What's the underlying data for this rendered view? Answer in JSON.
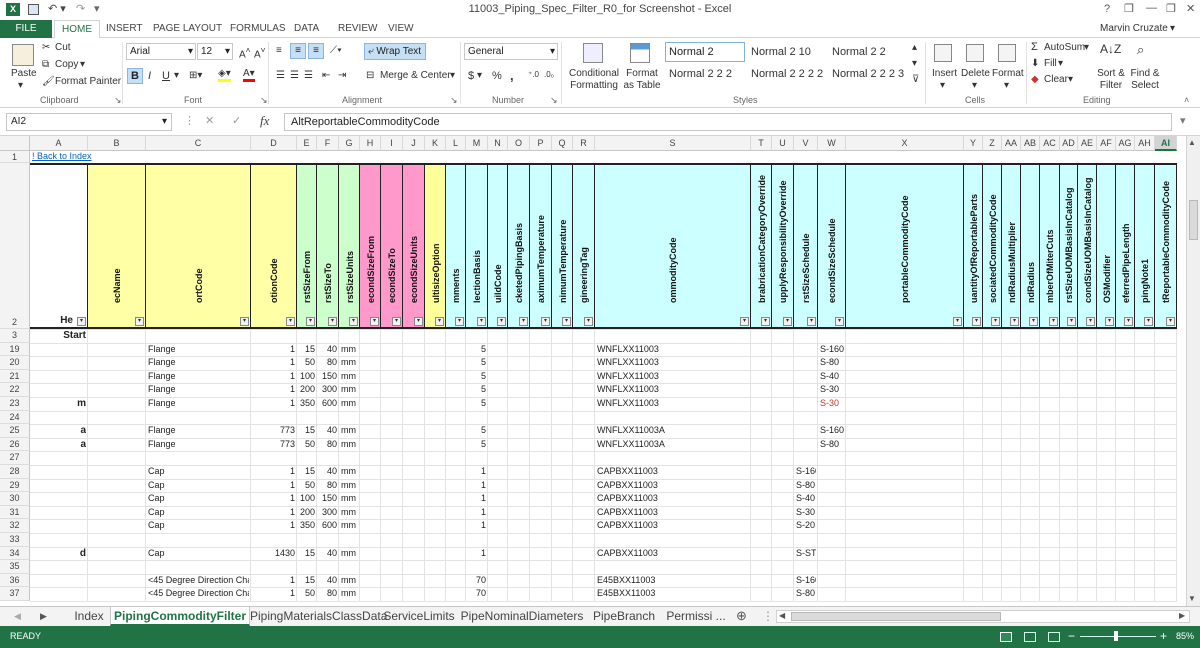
{
  "title_bar": {
    "title": "11003_Piping_Spec_Filter_R0_for Screenshot - Excel",
    "help": "?",
    "minimize": "—",
    "restore": "❐",
    "close": "✕"
  },
  "ribbon_tabs": [
    {
      "id": "file",
      "label": "FILE"
    },
    {
      "id": "home",
      "label": "HOME"
    },
    {
      "id": "insert",
      "label": "INSERT"
    },
    {
      "id": "pagelayout",
      "label": "PAGE LAYOUT"
    },
    {
      "id": "formulas",
      "label": "FORMULAS"
    },
    {
      "id": "data",
      "label": "DATA"
    },
    {
      "id": "review",
      "label": "REVIEW"
    },
    {
      "id": "view",
      "label": "VIEW"
    }
  ],
  "user": "Marvin Cruzate",
  "ribbon": {
    "clipboard": {
      "paste": "Paste",
      "cut": "Cut",
      "copy": "Copy",
      "format_painter": "Format Painter",
      "label": "Clipboard"
    },
    "font": {
      "name": "Arial",
      "size": "12",
      "label": "Font",
      "bold": "B",
      "italic": "I",
      "underline": "U"
    },
    "alignment": {
      "wrap": "Wrap Text",
      "merge": "Merge & Center",
      "label": "Alignment"
    },
    "number": {
      "format": "General",
      "currency": "$",
      "percent": "%",
      "comma": ",",
      "label": "Number"
    },
    "styles": {
      "conditional": "Conditional Formatting",
      "format_as_table": "Format as Table",
      "cells": [
        "Normal 2",
        "Normal 2 10",
        "Normal 2 2",
        "Normal 2 2 2",
        "Normal 2 2 2 2",
        "Normal 2 2 2 3"
      ],
      "label": "Styles"
    },
    "cells": {
      "insert": "Insert",
      "delete": "Delete",
      "format": "Format",
      "label": "Cells"
    },
    "editing": {
      "autosum": "AutoSum",
      "fill": "Fill",
      "clear": "Clear",
      "sort": "Sort & Filter",
      "find": "Find & Select",
      "label": "Editing"
    }
  },
  "formula_bar": {
    "name_box": "AI2",
    "fx": "fx",
    "content": "AltReportableCommodityCode"
  },
  "columns": [
    {
      "letter": "A",
      "width": 58
    },
    {
      "letter": "B",
      "width": 58
    },
    {
      "letter": "C",
      "width": 105
    },
    {
      "letter": "D",
      "width": 46
    },
    {
      "letter": "E",
      "width": 20
    },
    {
      "letter": "F",
      "width": 22
    },
    {
      "letter": "G",
      "width": 21
    },
    {
      "letter": "H",
      "width": 21
    },
    {
      "letter": "I",
      "width": 22
    },
    {
      "letter": "J",
      "width": 22
    },
    {
      "letter": "K",
      "width": 21
    },
    {
      "letter": "L",
      "width": 20
    },
    {
      "letter": "M",
      "width": 22
    },
    {
      "letter": "N",
      "width": 20
    },
    {
      "letter": "O",
      "width": 22
    },
    {
      "letter": "P",
      "width": 22
    },
    {
      "letter": "Q",
      "width": 21
    },
    {
      "letter": "R",
      "width": 22
    },
    {
      "letter": "S",
      "width": 156
    },
    {
      "letter": "T",
      "width": 21
    },
    {
      "letter": "U",
      "width": 22
    },
    {
      "letter": "V",
      "width": 24
    },
    {
      "letter": "W",
      "width": 28
    },
    {
      "letter": "X",
      "width": 118
    },
    {
      "letter": "Y",
      "width": 19
    },
    {
      "letter": "Z",
      "width": 19
    },
    {
      "letter": "AA",
      "width": 19
    },
    {
      "letter": "AB",
      "width": 19
    },
    {
      "letter": "AC",
      "width": 20
    },
    {
      "letter": "AD",
      "width": 18
    },
    {
      "letter": "AE",
      "width": 19
    },
    {
      "letter": "AF",
      "width": 19
    },
    {
      "letter": "AG",
      "width": 19
    },
    {
      "letter": "AH",
      "width": 20
    },
    {
      "letter": "AI",
      "width": 22
    }
  ],
  "header_row": [
    {
      "col": "A",
      "text": "He",
      "color": "#ffffff"
    },
    {
      "col": "B",
      "text": "ecName",
      "color": "#ffffa6"
    },
    {
      "col": "C",
      "text": "ortCode",
      "color": "#ffffa6"
    },
    {
      "col": "D",
      "text": "otionCode",
      "color": "#ffffa6"
    },
    {
      "col": "E",
      "text": "rstSizeFrom",
      "color": "#ccffcc"
    },
    {
      "col": "F",
      "text": "rstSizeTo",
      "color": "#ccffcc"
    },
    {
      "col": "G",
      "text": "rstSizeUnits",
      "color": "#ccffcc"
    },
    {
      "col": "H",
      "text": "econdSizeFrom",
      "color": "#ff99cc"
    },
    {
      "col": "I",
      "text": "econdSizeTo",
      "color": "#ff99cc"
    },
    {
      "col": "J",
      "text": "econdSizeUnits",
      "color": "#ff99cc"
    },
    {
      "col": "K",
      "text": "ultisizeOption",
      "color": "#ffff99"
    },
    {
      "col": "L",
      "text": "mments",
      "color": "#ccffff"
    },
    {
      "col": "M",
      "text": "lectionBasis",
      "color": "#ccffff"
    },
    {
      "col": "N",
      "text": "uildCode",
      "color": "#ccffff"
    },
    {
      "col": "O",
      "text": "cketedPipingBasis",
      "color": "#ccffff"
    },
    {
      "col": "P",
      "text": "aximumTemperature",
      "color": "#ccffff"
    },
    {
      "col": "Q",
      "text": "nimumTemperature",
      "color": "#ccffff"
    },
    {
      "col": "R",
      "text": "gineeringTag",
      "color": "#ccffff"
    },
    {
      "col": "S",
      "text": "ommodityCode",
      "color": "#ccffff"
    },
    {
      "col": "T",
      "text": "brabricationCategoryOverride",
      "color": "#ccffff"
    },
    {
      "col": "U",
      "text": "upplyResponsibilityOverride",
      "color": "#ccffff"
    },
    {
      "col": "V",
      "text": "rstSizeSchedule",
      "color": "#ccffff"
    },
    {
      "col": "W",
      "text": "econdSizeSchedule",
      "color": "#ccffff"
    },
    {
      "col": "X",
      "text": "portableCommodityCode",
      "color": "#ccffff"
    },
    {
      "col": "Y",
      "text": "uantityOfReportableParts",
      "color": "#ccffff"
    },
    {
      "col": "Z",
      "text": "sociatedCommodityCode",
      "color": "#ccffff"
    },
    {
      "col": "AA",
      "text": "ndRadiusMultiplier",
      "color": "#ccffff"
    },
    {
      "col": "AB",
      "text": "ndRadius",
      "color": "#ccffff"
    },
    {
      "col": "AC",
      "text": "mberOfMiterCuts",
      "color": "#ccffff"
    },
    {
      "col": "AD",
      "text": "rstSizeUOMBasisInCatalog",
      "color": "#ccffff"
    },
    {
      "col": "AE",
      "text": "condSizeUOMBasisInCatalog",
      "color": "#ccffff"
    },
    {
      "col": "AF",
      "text": "OSModifier",
      "color": "#ccffff"
    },
    {
      "col": "AG",
      "text": "eferredPipeLength",
      "color": "#ccffff"
    },
    {
      "col": "AH",
      "text": "pingNote1",
      "color": "#ccffff"
    },
    {
      "col": "AI",
      "text": "tReportableCommodityCode",
      "color": "#ccffff"
    }
  ],
  "row1": {
    "num": "1",
    "link": "! Back to Index"
  },
  "row2_num": "2",
  "row3": {
    "num": "3",
    "text": "Start"
  },
  "rows": [
    {
      "num": "19",
      "A": "",
      "C": "Flange",
      "D": "1",
      "E": "15",
      "F": "40",
      "G": "mm",
      "M": "5",
      "S": "WNFLXX11003",
      "V": "",
      "W": "S-160",
      "wred": false
    },
    {
      "num": "20",
      "A": "",
      "C": "Flange",
      "D": "1",
      "E": "50",
      "F": "80",
      "G": "mm",
      "M": "5",
      "S": "WNFLXX11003",
      "V": "",
      "W": "S-80",
      "wred": false
    },
    {
      "num": "21",
      "A": "",
      "C": "Flange",
      "D": "1",
      "E": "100",
      "F": "150",
      "G": "mm",
      "M": "5",
      "S": "WNFLXX11003",
      "V": "",
      "W": "S-40",
      "wred": false
    },
    {
      "num": "22",
      "A": "",
      "C": "Flange",
      "D": "1",
      "E": "200",
      "F": "300",
      "G": "mm",
      "M": "5",
      "S": "WNFLXX11003",
      "V": "",
      "W": "S-30",
      "wred": false
    },
    {
      "num": "23",
      "A": "m",
      "C": "Flange",
      "D": "1",
      "E": "350",
      "F": "600",
      "G": "mm",
      "M": "5",
      "S": "WNFLXX11003",
      "V": "",
      "W": "S-30",
      "wred": true
    },
    {
      "num": "24",
      "A": "",
      "C": "",
      "D": "",
      "E": "",
      "F": "",
      "G": "",
      "M": "",
      "S": "",
      "V": "",
      "W": "",
      "wred": false
    },
    {
      "num": "25",
      "A": "a",
      "C": "Flange",
      "D": "773",
      "E": "15",
      "F": "40",
      "G": "mm",
      "M": "5",
      "S": "WNFLXX11003A",
      "V": "",
      "W": "S-160",
      "wred": false
    },
    {
      "num": "26",
      "A": "a",
      "C": "Flange",
      "D": "773",
      "E": "50",
      "F": "80",
      "G": "mm",
      "M": "5",
      "S": "WNFLXX11003A",
      "V": "",
      "W": "S-80",
      "wred": false
    },
    {
      "num": "27",
      "A": "",
      "C": "",
      "D": "",
      "E": "",
      "F": "",
      "G": "",
      "M": "",
      "S": "",
      "V": "",
      "W": "",
      "wred": false
    },
    {
      "num": "28",
      "A": "",
      "C": "Cap",
      "D": "1",
      "E": "15",
      "F": "40",
      "G": "mm",
      "M": "1",
      "S": "CAPBXX11003",
      "V": "S-160",
      "W": "",
      "wred": false
    },
    {
      "num": "29",
      "A": "",
      "C": "Cap",
      "D": "1",
      "E": "50",
      "F": "80",
      "G": "mm",
      "M": "1",
      "S": "CAPBXX11003",
      "V": "S-80",
      "W": "",
      "wred": false
    },
    {
      "num": "30",
      "A": "",
      "C": "Cap",
      "D": "1",
      "E": "100",
      "F": "150",
      "G": "mm",
      "M": "1",
      "S": "CAPBXX11003",
      "V": "S-40",
      "W": "",
      "wred": false
    },
    {
      "num": "31",
      "A": "",
      "C": "Cap",
      "D": "1",
      "E": "200",
      "F": "300",
      "G": "mm",
      "M": "1",
      "S": "CAPBXX11003",
      "V": "S-30",
      "W": "",
      "wred": false
    },
    {
      "num": "32",
      "A": "",
      "C": "Cap",
      "D": "1",
      "E": "350",
      "F": "600",
      "G": "mm",
      "M": "1",
      "S": "CAPBXX11003",
      "V": "S-20",
      "W": "",
      "wred": false
    },
    {
      "num": "33",
      "A": "",
      "C": "",
      "D": "",
      "E": "",
      "F": "",
      "G": "",
      "M": "",
      "S": "",
      "V": "",
      "W": "",
      "wred": false
    },
    {
      "num": "34",
      "A": "d",
      "C": "Cap",
      "D": "1430",
      "E": "15",
      "F": "40",
      "G": "mm",
      "M": "1",
      "S": "CAPBXX11003",
      "V": "S-STD",
      "W": "",
      "wred": false
    },
    {
      "num": "35",
      "A": "",
      "C": "",
      "D": "",
      "E": "",
      "F": "",
      "G": "",
      "M": "",
      "S": "",
      "V": "",
      "W": "",
      "wred": false
    },
    {
      "num": "36",
      "A": "",
      "C": "<45 Degree Direction Char",
      "D": "1",
      "E": "15",
      "F": "40",
      "G": "mm",
      "M": "70",
      "S": "E45BXX11003",
      "V": "S-160",
      "W": "",
      "wred": false
    },
    {
      "num": "37",
      "A": "",
      "C": "<45 Degree Direction Char",
      "D": "1",
      "E": "50",
      "F": "80",
      "G": "mm",
      "M": "70",
      "S": "E45BXX11003",
      "V": "S-80",
      "W": "",
      "wred": false
    }
  ],
  "sheet_tabs": [
    "Index",
    "PipingCommodityFilter",
    "PipingMaterialsClassData",
    "ServiceLimits",
    "PipeNominalDiameters",
    "PipeBranch",
    "Permissi ..."
  ],
  "active_sheet": "PipingCommodityFilter",
  "status": {
    "ready": "READY",
    "zoom": "85%"
  },
  "colors": {
    "accent": "#217346",
    "header_border": "#222222",
    "red": "#c0392b"
  }
}
